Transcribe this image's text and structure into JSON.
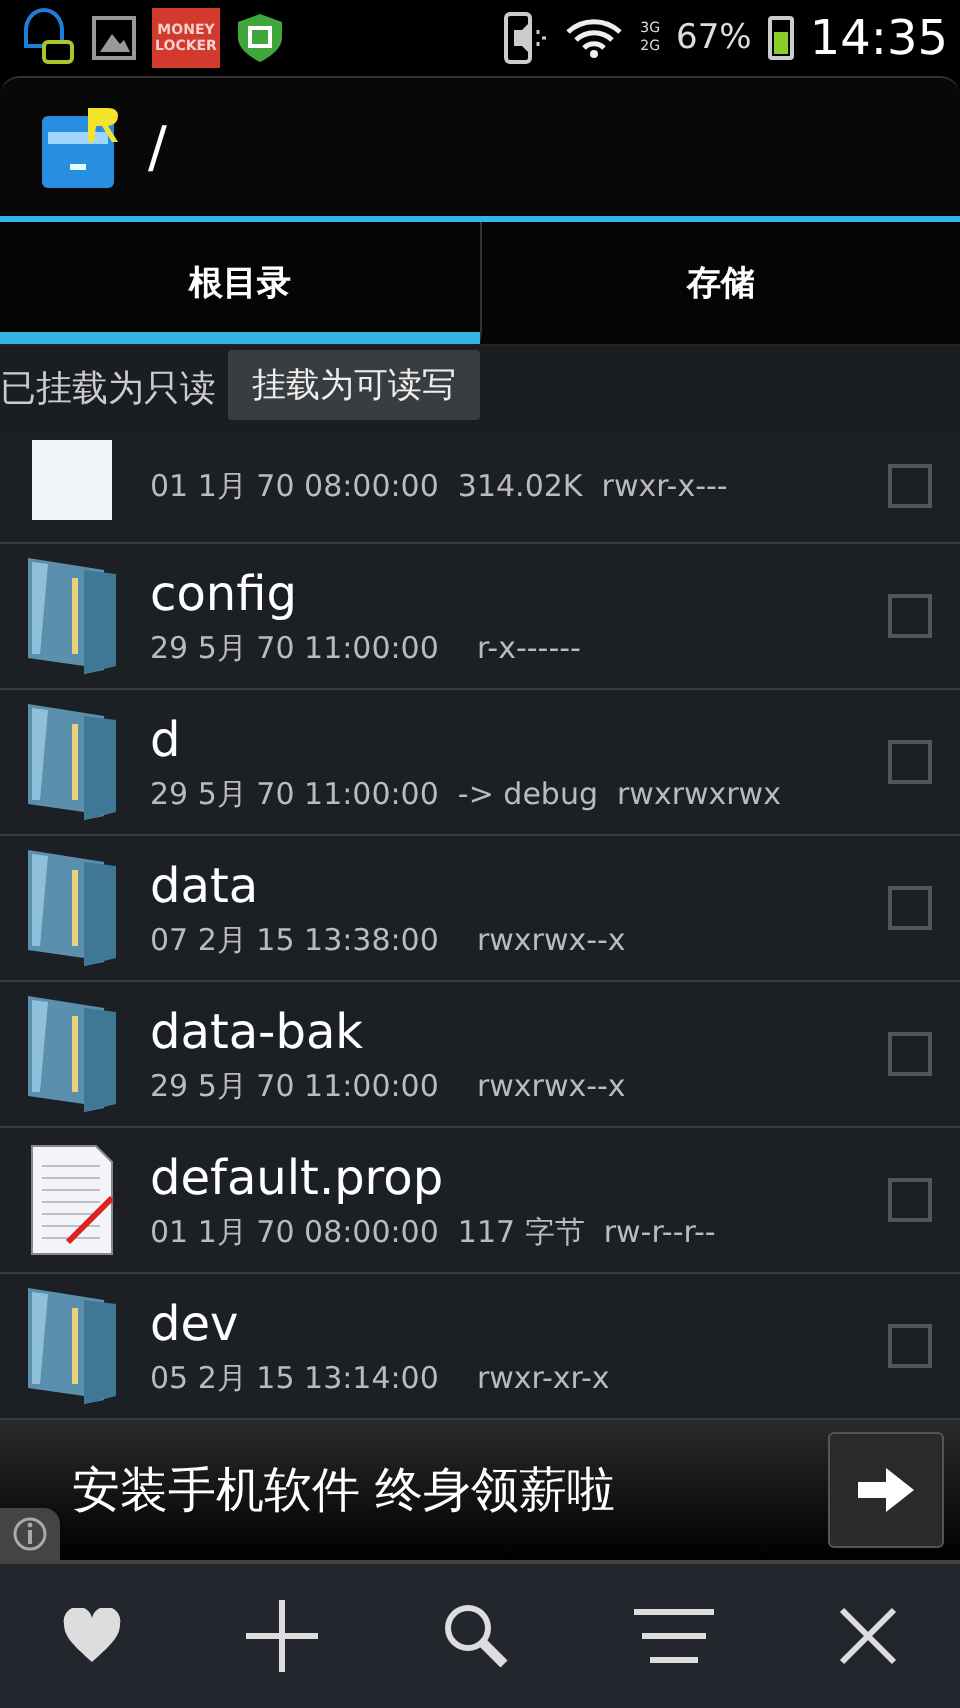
{
  "status_bar": {
    "network_labels": [
      "3G",
      "2G"
    ],
    "battery_text": "67%",
    "time": "14:35",
    "app_badge": [
      "MONEY",
      "LOCKER"
    ]
  },
  "header": {
    "path": "/"
  },
  "tabs": [
    {
      "label": "根目录",
      "selected": true
    },
    {
      "label": "存储",
      "selected": false
    }
  ],
  "mount_bar": {
    "status": "已挂载为只读",
    "button": "挂载为可读写"
  },
  "rows": [
    {
      "kind": "blank-file",
      "meta": "01 1月 70 08:00:00  314.02K  rwxr-x---",
      "checked": false
    },
    {
      "kind": "folder",
      "name": "config",
      "meta": "29 5月 70 11:00:00    r-x------",
      "checked": false
    },
    {
      "kind": "folder",
      "name": "d",
      "meta": "29 5月 70 11:00:00  -> debug  rwxrwxrwx",
      "checked": false
    },
    {
      "kind": "folder",
      "name": "data",
      "meta": "07 2月 15 13:38:00    rwxrwx--x",
      "checked": false
    },
    {
      "kind": "folder",
      "name": "data-bak",
      "meta": "29 5月 70 11:00:00    rwxrwx--x",
      "checked": false
    },
    {
      "kind": "text-file",
      "name": "default.prop",
      "meta": "01 1月 70 08:00:00  117 字节  rw-r--r--",
      "checked": false
    },
    {
      "kind": "folder",
      "name": "dev",
      "meta": "05 2月 15 13:14:00    rwxr-xr-x",
      "checked": false
    }
  ],
  "ad_banner": {
    "text": "安装手机软件 终身领薪啦"
  },
  "toolbar": [
    {
      "kind": "heart"
    },
    {
      "kind": "plus"
    },
    {
      "kind": "search"
    },
    {
      "kind": "menu"
    },
    {
      "kind": "close"
    }
  ]
}
